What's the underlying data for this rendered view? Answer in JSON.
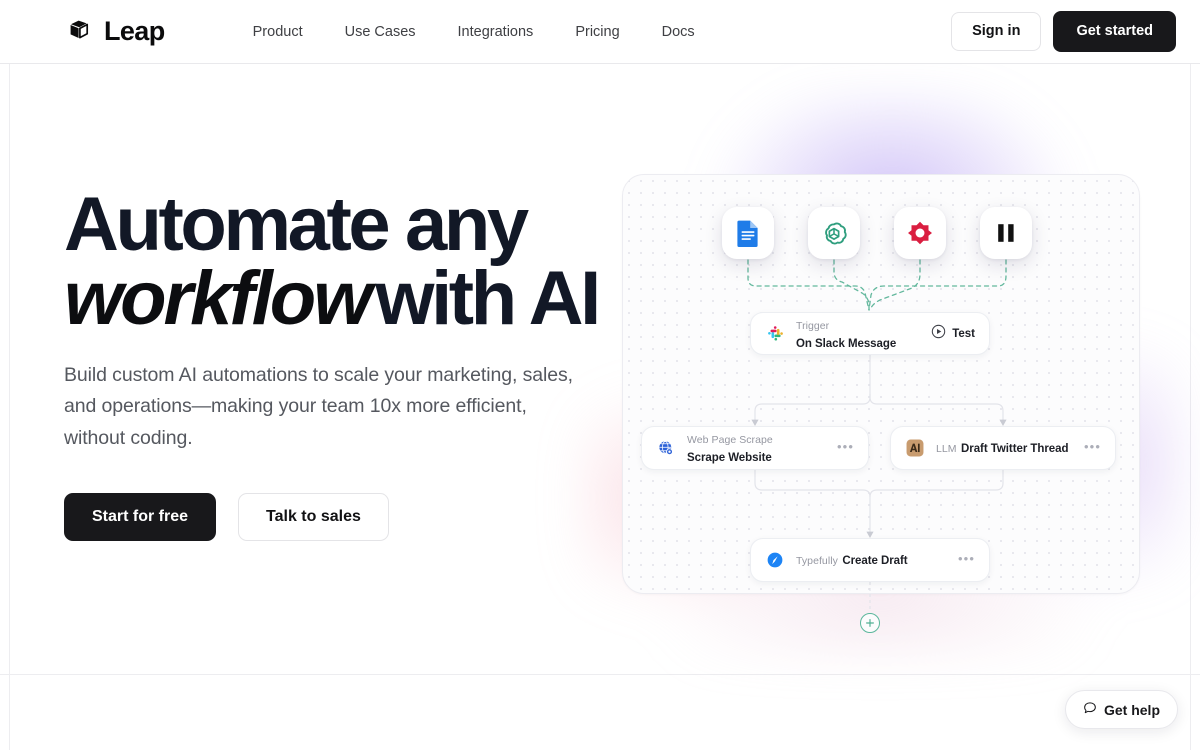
{
  "brand": {
    "name": "Leap",
    "logo_icon": "cube-logo-icon"
  },
  "nav": {
    "items": [
      {
        "label": "Product"
      },
      {
        "label": "Use Cases"
      },
      {
        "label": "Integrations"
      },
      {
        "label": "Pricing"
      },
      {
        "label": "Docs"
      }
    ],
    "sign_in_label": "Sign in",
    "get_started_label": "Get started"
  },
  "hero": {
    "headline_line1": "Automate any",
    "headline_italic": "workflow",
    "headline_rest": "with AI",
    "subhead": "Build custom AI automations to scale your marketing, sales, and operations—making your team 10x more efficient, without coding.",
    "primary_cta": "Start for free",
    "secondary_cta": "Talk to sales"
  },
  "illustration": {
    "app_chips": [
      {
        "name": "google-docs-icon",
        "label": "Google Docs"
      },
      {
        "name": "openai-icon",
        "label": "OpenAI"
      },
      {
        "name": "airtable-icon",
        "label": "Airtable"
      },
      {
        "name": "pause-icon",
        "label": "Pause"
      }
    ],
    "nodes": [
      {
        "id": "trigger",
        "icon": "slack-icon",
        "kicker": "Trigger",
        "title": "On Slack Message",
        "action_label": "Test",
        "action_icon": "play-circle-icon"
      },
      {
        "id": "scrape",
        "icon": "web-scrape-icon",
        "kicker": "Web Page Scrape",
        "title": "Scrape Website",
        "menu": "•••"
      },
      {
        "id": "llm",
        "icon": "anthropic-icon",
        "kicker": "LLM",
        "title": "Draft Twitter Thread",
        "menu": "•••"
      },
      {
        "id": "draft",
        "icon": "typefully-icon",
        "kicker": "Typefully",
        "title": "Create Draft",
        "menu": "•••"
      }
    ],
    "add_node_label": "+",
    "accent_colors": {
      "wire_dashed": "#63b89d",
      "wire_solid": "#e3e4ea",
      "add_node": "#4fae93",
      "glow_purple": "#a88ef0",
      "glow_pink": "#f3aaba"
    }
  },
  "widget": {
    "help_label": "Get help",
    "help_icon": "chat-bubble-icon"
  }
}
